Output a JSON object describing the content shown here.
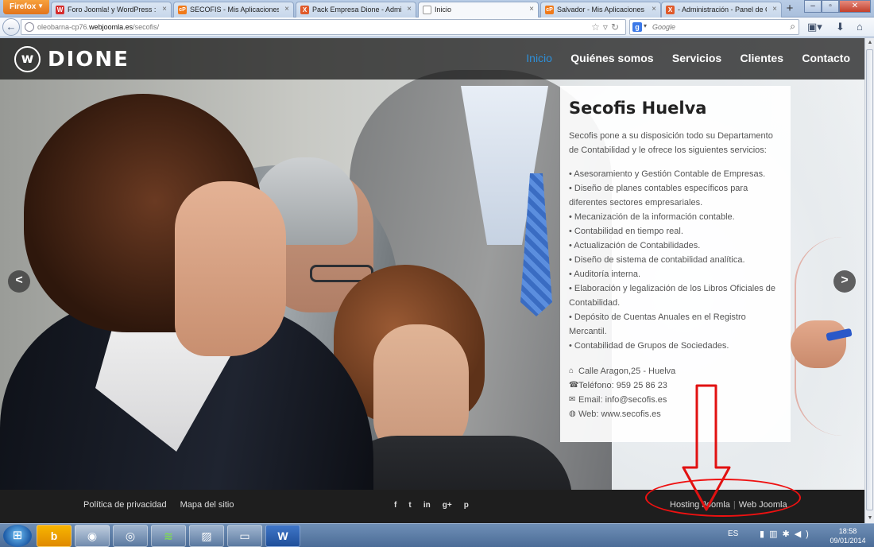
{
  "browser": {
    "menu_label": "Firefox",
    "tabs": [
      {
        "label": "Foro Joomla! y WordPress :: Discu...",
        "fav": "W",
        "fav_color": "#d62c2c"
      },
      {
        "label": "SECOFIS - Mis Aplicaciones - Pack...",
        "fav": "cP",
        "fav_color": "#f07a1a"
      },
      {
        "label": "Pack Empresa Dione - Administra...",
        "fav": "X",
        "fav_color": "#e05a2a"
      },
      {
        "label": "Inicio",
        "fav": "",
        "fav_color": "#ffffff"
      },
      {
        "label": "Salvador - Mis Aplicaciones - Pack...",
        "fav": "cP",
        "fav_color": "#f07a1a"
      },
      {
        "label": "- Administración - Panel de Cont...",
        "fav": "X",
        "fav_color": "#e05a2a"
      }
    ],
    "url_prefix": "oleobarna-cp76.",
    "url_domain": "webjoomla.es",
    "url_path": "/secofis/",
    "search_placeholder": "Google",
    "search_engine_icon": "google-icon"
  },
  "site": {
    "logo_mark": "w",
    "logo_text": "DIONE",
    "nav": [
      {
        "label": "Inicio",
        "active": true
      },
      {
        "label": "Quiénes somos",
        "active": false
      },
      {
        "label": "Servicios",
        "active": false
      },
      {
        "label": "Clientes",
        "active": false
      },
      {
        "label": "Contacto",
        "active": false
      }
    ],
    "nav_active_color": "#2e8fd8"
  },
  "card": {
    "title": "Secofis Huelva",
    "intro": "Secofis pone a su disposición todo su Departamento de Contabilidad y le ofrece los siguientes servicios:",
    "services": [
      "• Asesoramiento y Gestión Contable de Empresas.",
      "• Diseño de planes contables específicos para diferentes sectores empresariales.",
      "• Mecanización de la información contable.",
      "• Contabilidad en tiempo real.",
      "• Actualización de Contabilidades.",
      "• Diseño de sistema de contabilidad analítica.",
      "• Auditoría interna.",
      "• Elaboración y legalización de los Libros Oficiales de Contabilidad.",
      "• Depósito de Cuentas Anuales en el Registro Mercantil.",
      "• Contabilidad de Grupos de Sociedades."
    ],
    "contact": {
      "address": "Calle Aragon,25 - Huelva",
      "phone": "Teléfono: 959 25 86 23",
      "email": "Email: info@secofis.es",
      "web": "Web: www.secofis.es"
    }
  },
  "slider": {
    "prev": "<",
    "next": ">"
  },
  "footer": {
    "links": [
      "Política de privacidad",
      "Mapa del sitio"
    ],
    "social": [
      "f",
      "t",
      "in",
      "g+",
      "p"
    ],
    "hosting": "Hosting Joomla",
    "separator": "|",
    "web": "Web Joomla"
  },
  "annotation": {
    "color": "#e11111"
  },
  "taskbar": {
    "lang": "ES",
    "time": "18:58",
    "date": "09/01/2014"
  }
}
